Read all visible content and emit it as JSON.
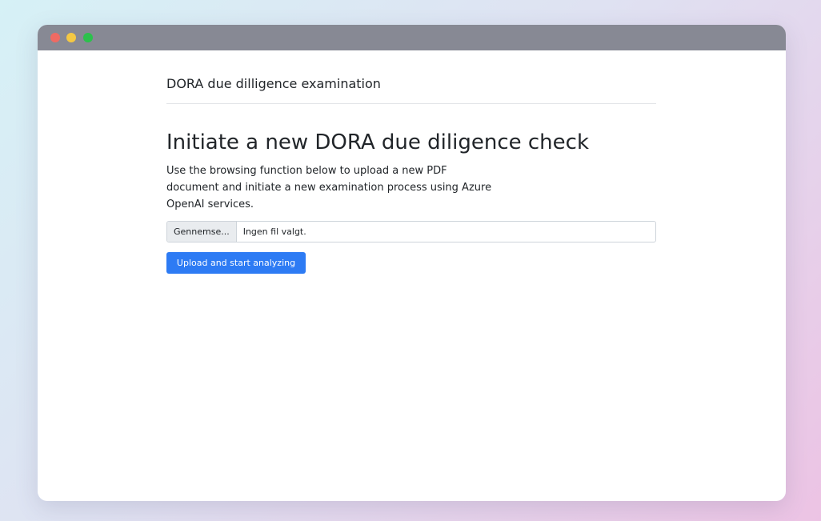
{
  "window": {
    "controls": [
      "close",
      "minimize",
      "maximize"
    ]
  },
  "navbar": {
    "brand": "DORA due dilligence examination"
  },
  "main": {
    "heading": "Initiate a new DORA due diligence check",
    "description": "Use the browsing function below to upload a new PDF document and initiate a new examination process using Azure OpenAI services.",
    "file_input": {
      "browse_label": "Gennemse...",
      "file_name": "Ingen fil valgt."
    },
    "submit_label": "Upload and start analyzing"
  },
  "colors": {
    "titlebar": "#878994",
    "close": "#ef6a63",
    "minimize": "#f4c843",
    "maximize": "#2cc14c",
    "primary_button": "#2d7bf4"
  }
}
